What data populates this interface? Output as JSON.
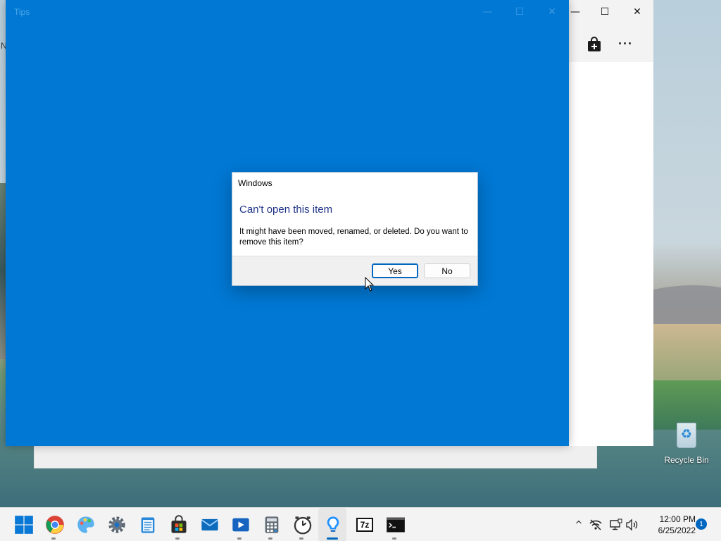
{
  "desktop": {
    "edge_text": "N",
    "recycle_bin_label": "Recycle Bin"
  },
  "store_window": {
    "maximize_glyph": "☐",
    "close_glyph": "✕",
    "minimize_glyph": "—",
    "more_glyph": "···"
  },
  "tips_window": {
    "title": "Tips",
    "minimize_glyph": "—",
    "maximize_glyph": "☐",
    "close_glyph": "✕",
    "background_color": "#0078d4"
  },
  "dialog": {
    "caption": "Windows",
    "heading": "Can't open this item",
    "message": "It might have been moved, renamed, or deleted. Do you want to remove this item?",
    "yes_label": "Yes",
    "no_label": "No",
    "heading_color": "#1e3287"
  },
  "taskbar": {
    "apps": [
      {
        "name": "start",
        "icon": "windows-logo-icon",
        "running": false
      },
      {
        "name": "chrome",
        "icon": "chrome-icon",
        "running": true
      },
      {
        "name": "paint",
        "icon": "paint-icon",
        "running": false
      },
      {
        "name": "settings",
        "icon": "gear-icon",
        "running": false
      },
      {
        "name": "notepad",
        "icon": "notepad-icon",
        "running": false
      },
      {
        "name": "store",
        "icon": "store-icon",
        "running": true
      },
      {
        "name": "mail",
        "icon": "mail-icon",
        "running": false
      },
      {
        "name": "media-player",
        "icon": "media-player-icon",
        "running": true
      },
      {
        "name": "calculator",
        "icon": "calculator-icon",
        "running": true
      },
      {
        "name": "clock",
        "icon": "clock-icon",
        "running": true
      },
      {
        "name": "tips",
        "icon": "tips-bulb-icon",
        "running": true,
        "active": true
      },
      {
        "name": "7zip",
        "icon": "7zip-icon",
        "running": false,
        "label": "7z"
      },
      {
        "name": "terminal",
        "icon": "terminal-icon",
        "running": true
      }
    ],
    "tray": {
      "chevron_glyph": "^",
      "time": "12:00 PM",
      "date": "6/25/2022",
      "notification_count": "1"
    },
    "accent_color": "#0067c0"
  }
}
